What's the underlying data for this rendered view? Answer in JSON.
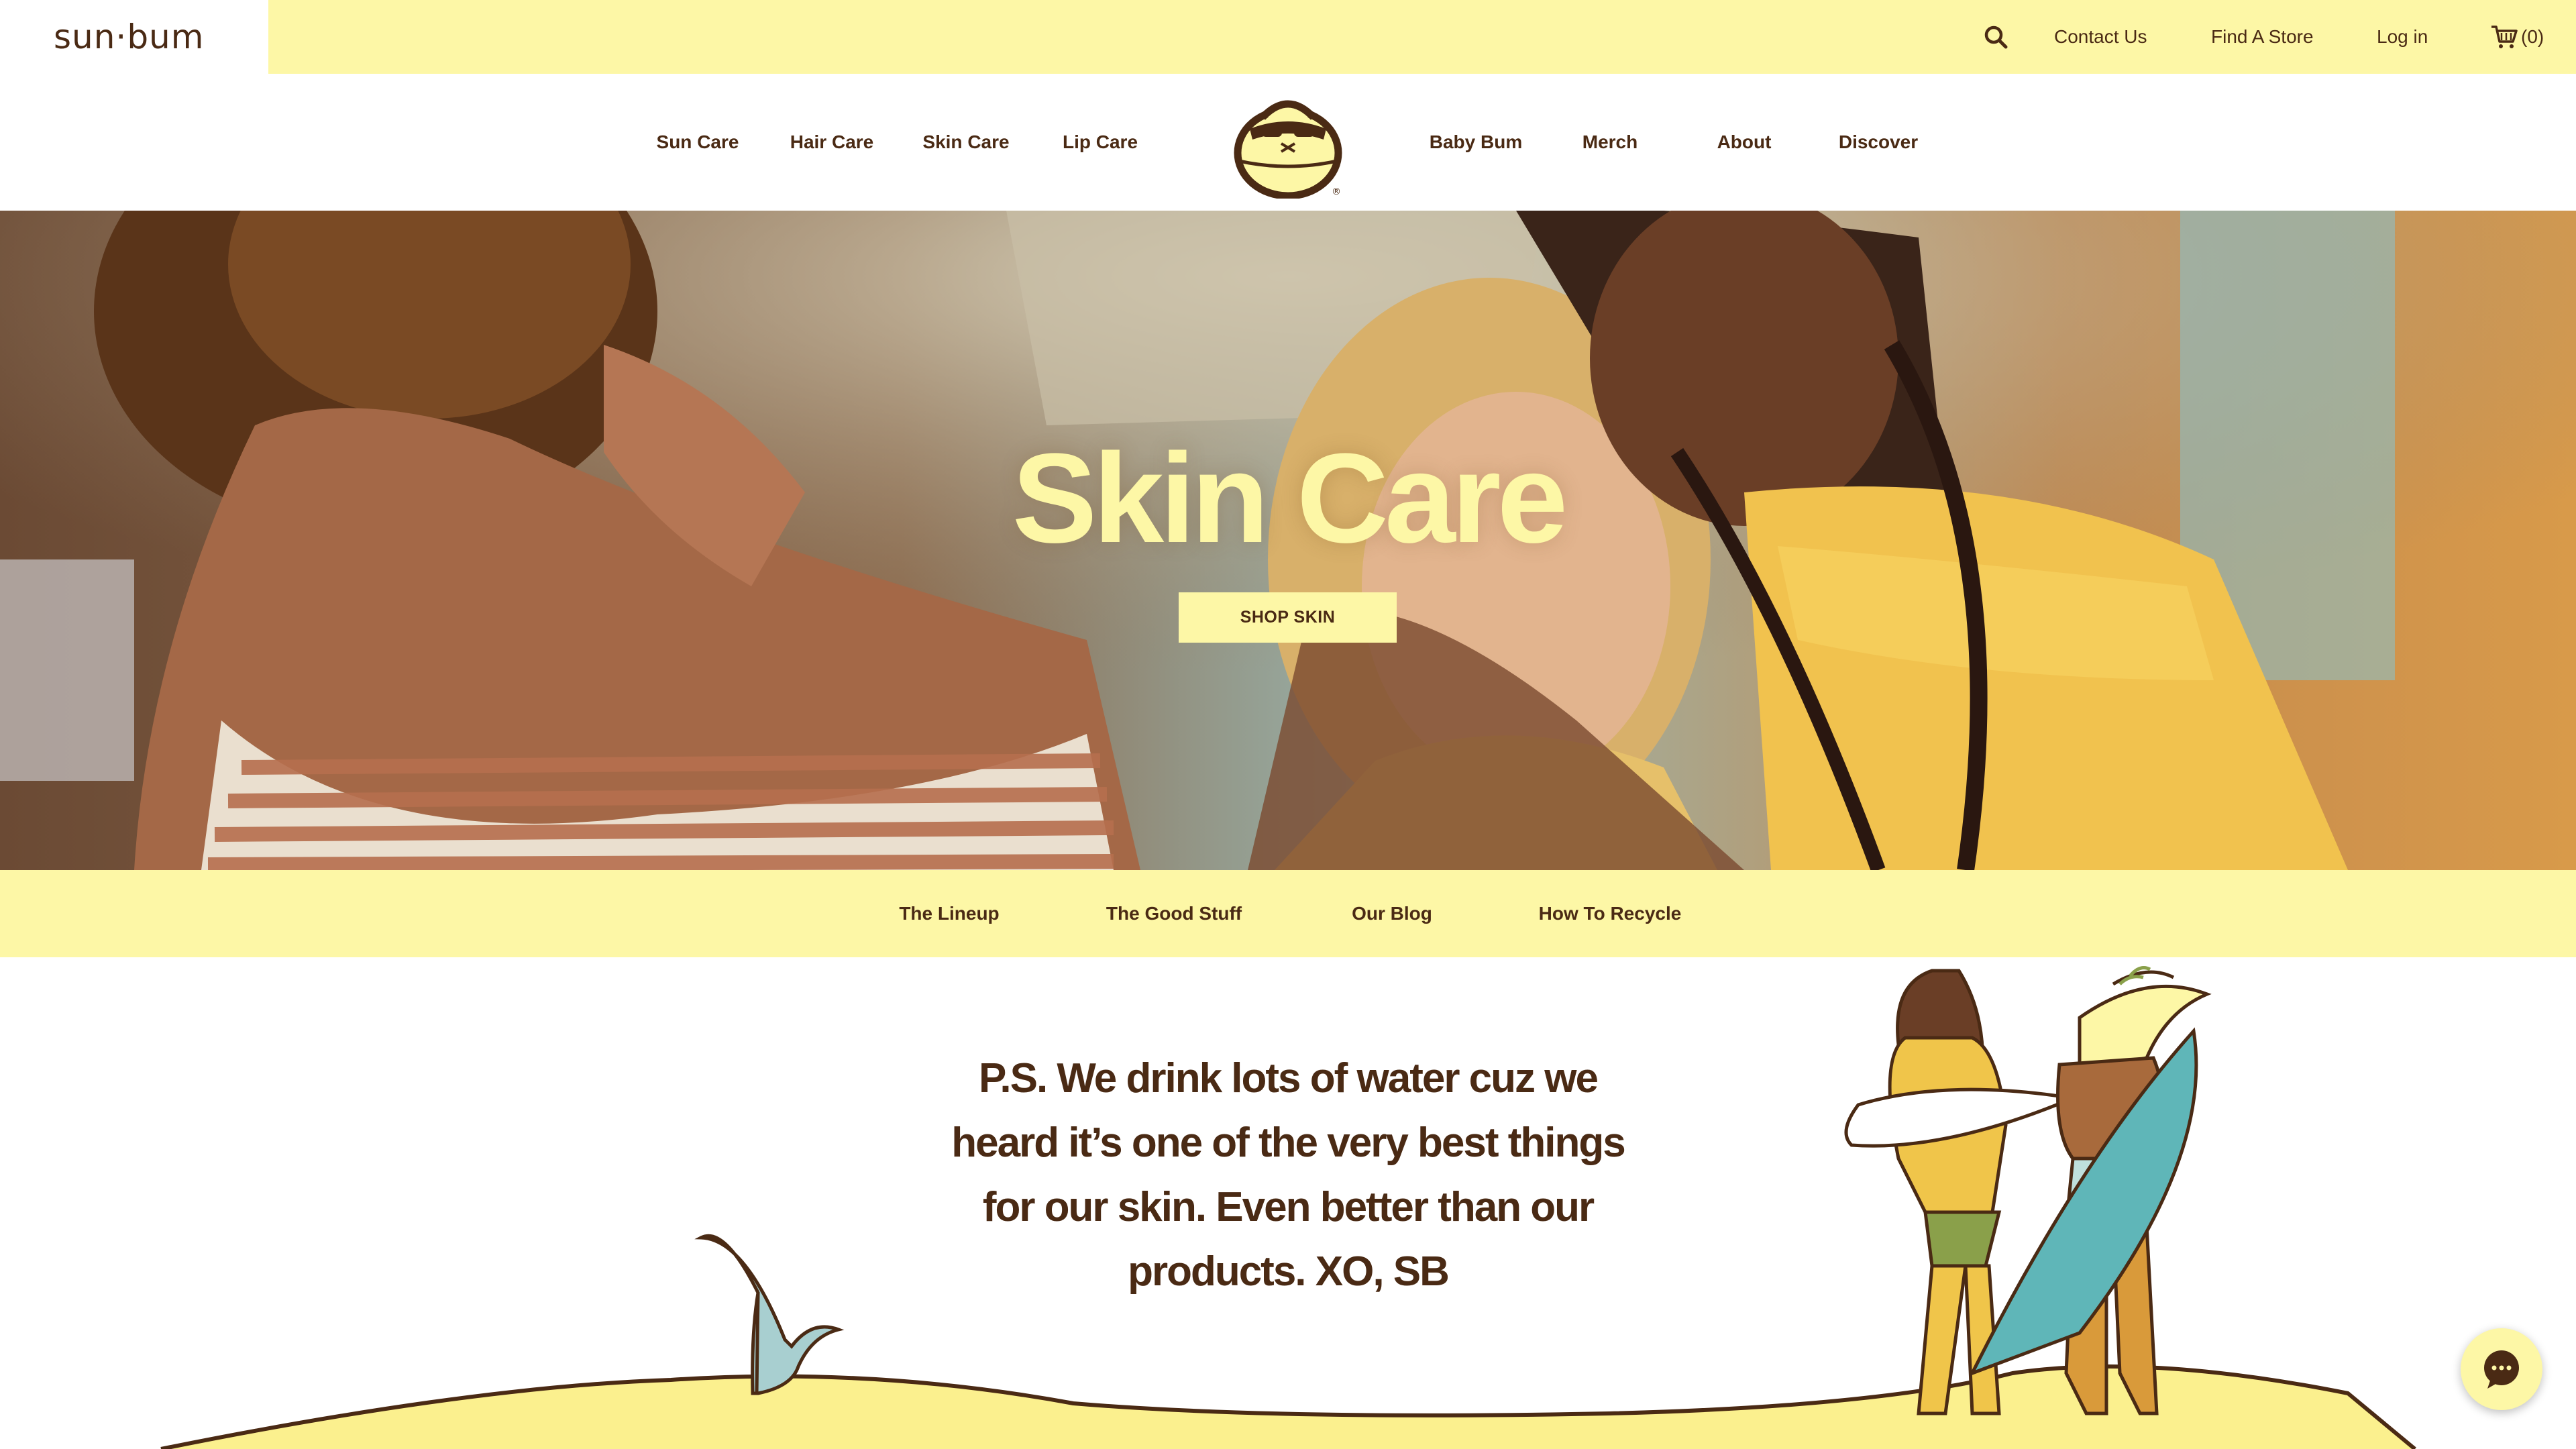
{
  "brand": {
    "wordmark": "sun·bum"
  },
  "utility_nav": {
    "search_icon": "search-icon",
    "contact": "Contact Us",
    "find_store": "Find A Store",
    "login": "Log in",
    "cart_icon": "cart-icon",
    "cart_count": "(0)"
  },
  "main_nav": {
    "items_left": [
      "Sun Care",
      "Hair Care",
      "Skin Care",
      "Lip Care"
    ],
    "items_right": [
      "Baby Bum",
      "Merch",
      "About",
      "Discover"
    ],
    "logo_icon": "sonny-mascot-icon"
  },
  "hero": {
    "title": "Skin Care",
    "button": "SHOP SKIN"
  },
  "sub_nav": {
    "items": [
      "The Lineup",
      "The Good Stuff",
      "Our Blog",
      "How To Recycle"
    ]
  },
  "content": {
    "quote_lines": [
      "P.S. We drink lots of water cuz we",
      "heard it’s one of the very best things",
      "for our skin. Even better than our",
      "products. XO, SB"
    ]
  },
  "chat": {
    "icon": "chat-bubble-icon"
  },
  "colors": {
    "accent_yellow": "#fdf7a6",
    "brand_brown": "#4a2a14",
    "sand": "#fbf08e"
  }
}
